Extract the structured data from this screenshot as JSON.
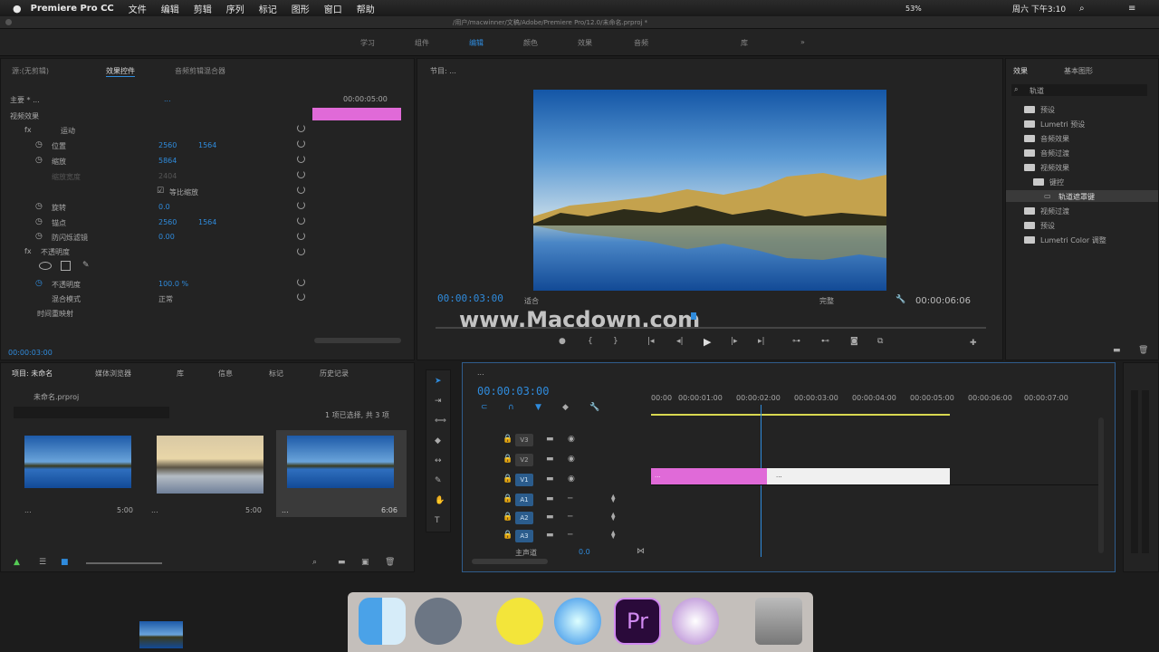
{
  "menubar": {
    "app": "Premiere Pro CC",
    "items": [
      "文件",
      "编辑",
      "剪辑",
      "序列",
      "标记",
      "图形",
      "窗口",
      "帮助"
    ],
    "battery": "53%",
    "clock": "周六 下午3:10"
  },
  "titlebar": {
    "path": "/用户/macwinner/文稿/Adobe/Premiere Pro/12.0/未命名.prproj *"
  },
  "workspaces": [
    "学习",
    "组件",
    "编辑",
    "颜色",
    "效果",
    "音频",
    "库"
  ],
  "effect_controls": {
    "tabs": [
      "源:(无剪辑)",
      "效果控件",
      "音频剪辑混合器"
    ],
    "master": "主要 * ...",
    "clip": "...",
    "timecode": "00:00:05:00",
    "section": "视频效果",
    "motion": "运动",
    "props": [
      {
        "label": "位置",
        "v1": "2560",
        "v2": "1564"
      },
      {
        "label": "缩放",
        "v1": "5864",
        "v2": ""
      },
      {
        "label": "缩放宽度",
        "v1": "2404",
        "v2": ""
      },
      {
        "label": "",
        "v1": "等比缩放",
        "v2": ""
      },
      {
        "label": "旋转",
        "v1": "0.0",
        "v2": ""
      },
      {
        "label": "锚点",
        "v1": "2560",
        "v2": "1564"
      },
      {
        "label": "防闪烁滤镜",
        "v1": "0.00",
        "v2": ""
      }
    ],
    "opacity": "不透明度",
    "opacity_val": "100.0 %",
    "blend_label": "混合模式",
    "blend_val": "正常",
    "time_remap": "时间重映射",
    "bottom_tc": "00:00:03:00"
  },
  "program_monitor": {
    "title": "节目: ...",
    "tc_left": "00:00:03:00",
    "fit": "适合",
    "quality": "完整",
    "tc_right": "00:00:06:06",
    "watermark": "www.Macdown.com"
  },
  "effects_panel": {
    "tabs": [
      "效果",
      "基本图形"
    ],
    "search": "轨道",
    "items": [
      "预设",
      "Lumetri 预设",
      "音频效果",
      "音频过渡",
      "视频效果",
      "键控",
      "轨道遮罩键",
      "视频过渡",
      "预设",
      "Lumetri Color 调整"
    ]
  },
  "project_panel": {
    "tabs": [
      "项目: 未命名",
      "媒体浏览器",
      "库",
      "信息",
      "标记",
      "历史记录"
    ],
    "name": "未命名.prproj",
    "count": "1 项已选择, 共 3 项",
    "clips": [
      {
        "name": "...",
        "dur": "5:00"
      },
      {
        "name": "...",
        "dur": "5:00"
      },
      {
        "name": "...",
        "dur": "6:06"
      }
    ]
  },
  "timeline": {
    "title": "...",
    "tc": "00:00:03:00",
    "ruler": [
      "00:00",
      "00:00:01:00",
      "00:00:02:00",
      "00:00:03:00",
      "00:00:04:00",
      "00:00:05:00",
      "00:00:06:00",
      "00:00:07:00",
      "00:00:08:00"
    ],
    "tracks": [
      "V3",
      "V2",
      "V1",
      "A1",
      "A2",
      "A3",
      "主声道"
    ],
    "master_val": "0.0",
    "clip_v1a": "...",
    "clip_v1b": "..."
  },
  "colors": {
    "accent": "#2f8bdc",
    "clip_pink": "#e06ad8",
    "panel": "#232323"
  }
}
